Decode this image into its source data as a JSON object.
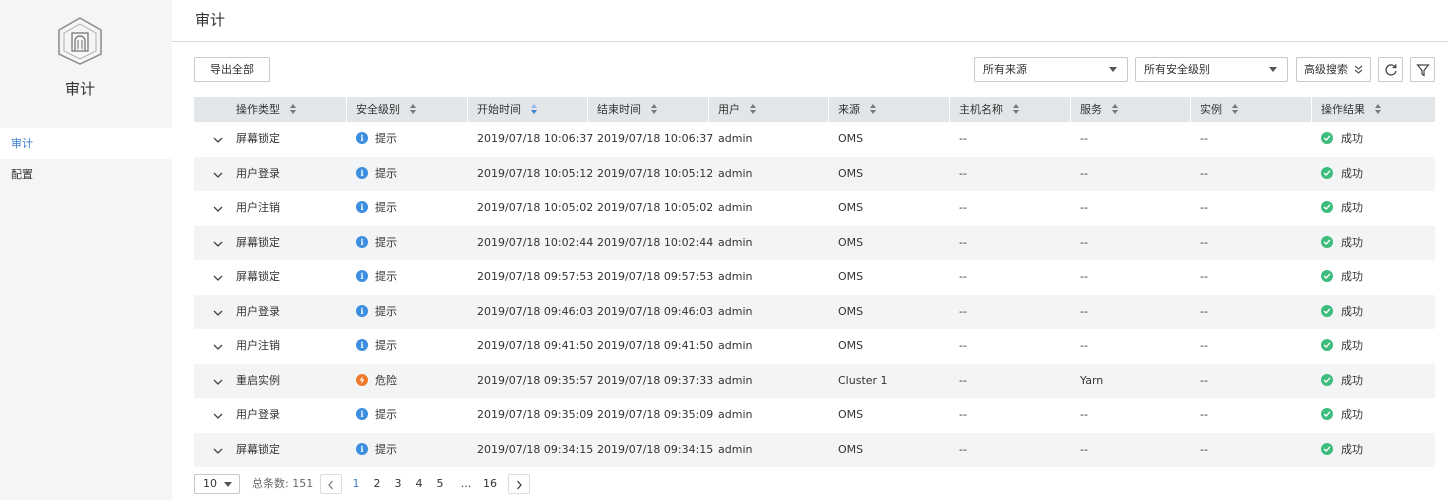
{
  "sidebar": {
    "title": "审计",
    "items": [
      {
        "label": "审计",
        "active": true
      },
      {
        "label": "配置",
        "active": false
      }
    ]
  },
  "header": {
    "title": "审计"
  },
  "toolbar": {
    "export_label": "导出全部",
    "source_select": "所有来源",
    "level_select": "所有安全级别",
    "advanced_search": "高级搜索"
  },
  "table": {
    "columns": [
      "操作类型",
      "安全级别",
      "开始时间",
      "结束时间",
      "用户",
      "来源",
      "主机名称",
      "服务",
      "实例",
      "操作结果"
    ],
    "rows": [
      {
        "op": "屏幕锁定",
        "level": "提示",
        "level_type": "info",
        "start": "2019/07/18 10:06:37",
        "end": "2019/07/18 10:06:37",
        "user": "admin",
        "source": "OMS",
        "host": "--",
        "service": "--",
        "instance": "--",
        "result": "成功"
      },
      {
        "op": "用户登录",
        "level": "提示",
        "level_type": "info",
        "start": "2019/07/18 10:05:12",
        "end": "2019/07/18 10:05:12",
        "user": "admin",
        "source": "OMS",
        "host": "--",
        "service": "--",
        "instance": "--",
        "result": "成功"
      },
      {
        "op": "用户注销",
        "level": "提示",
        "level_type": "info",
        "start": "2019/07/18 10:05:02",
        "end": "2019/07/18 10:05:02",
        "user": "admin",
        "source": "OMS",
        "host": "--",
        "service": "--",
        "instance": "--",
        "result": "成功"
      },
      {
        "op": "屏幕锁定",
        "level": "提示",
        "level_type": "info",
        "start": "2019/07/18 10:02:44",
        "end": "2019/07/18 10:02:44",
        "user": "admin",
        "source": "OMS",
        "host": "--",
        "service": "--",
        "instance": "--",
        "result": "成功"
      },
      {
        "op": "屏幕锁定",
        "level": "提示",
        "level_type": "info",
        "start": "2019/07/18 09:57:53",
        "end": "2019/07/18 09:57:53",
        "user": "admin",
        "source": "OMS",
        "host": "--",
        "service": "--",
        "instance": "--",
        "result": "成功"
      },
      {
        "op": "用户登录",
        "level": "提示",
        "level_type": "info",
        "start": "2019/07/18 09:46:03",
        "end": "2019/07/18 09:46:03",
        "user": "admin",
        "source": "OMS",
        "host": "--",
        "service": "--",
        "instance": "--",
        "result": "成功"
      },
      {
        "op": "用户注销",
        "level": "提示",
        "level_type": "info",
        "start": "2019/07/18 09:41:50",
        "end": "2019/07/18 09:41:50",
        "user": "admin",
        "source": "OMS",
        "host": "--",
        "service": "--",
        "instance": "--",
        "result": "成功"
      },
      {
        "op": "重启实例",
        "level": "危险",
        "level_type": "danger",
        "start": "2019/07/18 09:35:57",
        "end": "2019/07/18 09:37:33",
        "user": "admin",
        "source": "Cluster 1",
        "host": "--",
        "service": "Yarn",
        "instance": "--",
        "result": "成功"
      },
      {
        "op": "用户登录",
        "level": "提示",
        "level_type": "info",
        "start": "2019/07/18 09:35:09",
        "end": "2019/07/18 09:35:09",
        "user": "admin",
        "source": "OMS",
        "host": "--",
        "service": "--",
        "instance": "--",
        "result": "成功"
      },
      {
        "op": "屏幕锁定",
        "level": "提示",
        "level_type": "info",
        "start": "2019/07/18 09:34:15",
        "end": "2019/07/18 09:34:15",
        "user": "admin",
        "source": "OMS",
        "host": "--",
        "service": "--",
        "instance": "--",
        "result": "成功"
      }
    ]
  },
  "pagination": {
    "page_size": "10",
    "total": "总条数: 151",
    "pages": [
      "1",
      "2",
      "3",
      "4",
      "5",
      "...",
      "16"
    ],
    "current": "1"
  },
  "colors": {
    "accent": "#3b7fd1",
    "info": "#3b8ee0",
    "danger": "#f07a2b",
    "success": "#3dbd7d"
  }
}
